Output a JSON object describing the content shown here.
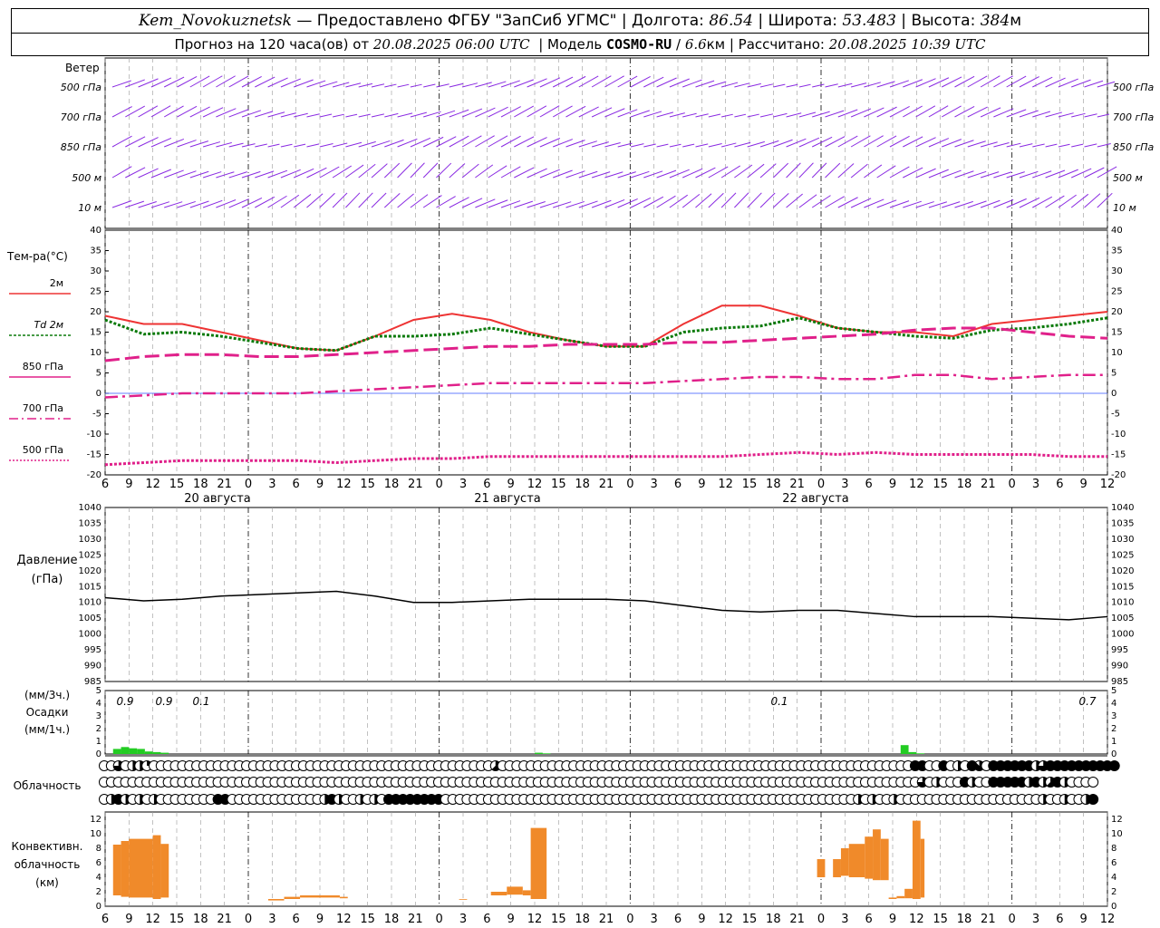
{
  "header": {
    "station": "Kem_Novokuznetsk",
    "sep": " — ",
    "provider": "Предоставлено ФГБУ \"ЗапСиб УГМС\"",
    "lon_label": "Долгота:",
    "lon_value": "86.54",
    "lat_label": "Широта:",
    "lat_value": "53.483",
    "alt_label": "Высота:",
    "alt_value": "384",
    "alt_unit": "м",
    "forecast_label": "Прогноз на 120 часа(ов) от",
    "forecast_time": "20.08.2025 06:00 UTC",
    "model_label": "Модель",
    "model_name": "COSMO-RU",
    "model_res": "6.6",
    "model_res_unit": "км",
    "calc_label": "Рассчитано:",
    "calc_time": "20.08.2025 10:39 UTC"
  },
  "labels": {
    "wind_title": "Ветер",
    "wind_levels": [
      "500 гПа",
      "700 гПа",
      "850 гПа",
      "500 м",
      "10 м"
    ],
    "temp_title": "Тем-ра(°C)",
    "temp_legend": [
      "2м",
      "Td 2м",
      "850 гПа",
      "700 гПа",
      "500 гПа"
    ],
    "pres_title_1": "Давление",
    "pres_title_2": "(гПа)",
    "precip_title_1": "(мм/3ч.)",
    "precip_title_2": "Осадки",
    "precip_title_3": "(мм/1ч.)",
    "cloud_title": "Облачность",
    "conv_title_1": "Конвективн.",
    "conv_title_2": "облачность",
    "conv_title_3": "(км)",
    "dates": [
      "20 августа",
      "21 августа",
      "22 августа"
    ],
    "precip_values": [
      "0.9",
      "0.9",
      "0.1",
      "0.1",
      "0.7"
    ]
  },
  "colors": {
    "wind": "#8a2be2",
    "t2m": "#ee3333",
    "td2m": "#0a7a0a",
    "t850": "#e0208a",
    "precip": "#22cc22",
    "conv": "#f08a2a",
    "grid": "#999999"
  },
  "chart_data": [
    {
      "type": "line",
      "title": "Тем-ра(°C)",
      "x_hours_utc": [
        6,
        9,
        12,
        15,
        18,
        21,
        0,
        3,
        6,
        9,
        12,
        15,
        18,
        21,
        0,
        3,
        6,
        9,
        12,
        15,
        18,
        21,
        0,
        3,
        6,
        9,
        12
      ],
      "ylim": [
        -20,
        40
      ],
      "series": [
        {
          "name": "2м",
          "values": [
            19,
            17,
            17,
            15,
            13,
            11,
            10.5,
            14,
            18,
            19.5,
            18,
            15,
            13,
            11.5,
            11.5,
            17,
            21.5,
            21.5,
            19,
            16,
            15,
            15,
            14,
            17,
            18,
            19,
            20
          ]
        },
        {
          "name": "Td 2м",
          "values": [
            18,
            14.5,
            15,
            14,
            12.5,
            11,
            10.5,
            14,
            14,
            14.5,
            16,
            14.5,
            13,
            11.5,
            11.5,
            15,
            16,
            16.5,
            18.5,
            16,
            15,
            14,
            13.5,
            15.5,
            16,
            17,
            18.5
          ]
        },
        {
          "name": "850 гПа",
          "values": [
            8,
            9,
            9.5,
            9.5,
            9,
            9,
            9.5,
            10,
            10.5,
            11,
            11.5,
            11.5,
            12,
            12,
            12,
            12.5,
            12.5,
            13,
            13.5,
            14,
            14.5,
            15.5,
            16,
            16,
            15,
            14,
            13.5
          ]
        },
        {
          "name": "700 гПа",
          "values": [
            -1,
            -0.5,
            0,
            0,
            0,
            0,
            0.5,
            1,
            1.5,
            2,
            2.5,
            2.5,
            2.5,
            2.5,
            2.5,
            3,
            3.5,
            4,
            4,
            3.5,
            3.5,
            4.5,
            4.5,
            3.5,
            4,
            4.5,
            4.5
          ]
        },
        {
          "name": "500 гПа",
          "values": [
            -17.5,
            -17,
            -16.5,
            -16.5,
            -16.5,
            -16.5,
            -17,
            -16.5,
            -16,
            -16,
            -15.5,
            -15.5,
            -15.5,
            -15.5,
            -15.5,
            -15.5,
            -15.5,
            -15,
            -14.5,
            -15,
            -14.5,
            -15,
            -15,
            -15,
            -15,
            -15.5,
            -15.5
          ]
        }
      ]
    },
    {
      "type": "line",
      "title": "Давление",
      "ylabel": "(гПа)",
      "x_hours_utc": [
        6,
        9,
        12,
        15,
        18,
        21,
        0,
        3,
        6,
        9,
        12,
        15,
        18,
        21,
        0,
        3,
        6,
        9,
        12,
        15,
        18,
        21,
        0,
        3,
        6,
        9,
        12
      ],
      "ylim": [
        985,
        1040
      ],
      "series": [
        {
          "name": "Давление",
          "values": [
            1011.5,
            1010.5,
            1011,
            1012,
            1012.5,
            1013,
            1013.5,
            1012,
            1010,
            1010,
            1010.5,
            1011,
            1011,
            1011,
            1010.5,
            1009,
            1007.5,
            1007,
            1007.5,
            1007.5,
            1006.5,
            1005.5,
            1005.5,
            1005.5,
            1005,
            1004.5,
            1005.5
          ]
        }
      ]
    },
    {
      "type": "bar",
      "title": "Осадки",
      "ylabel": "(мм/1ч.)",
      "ylim": [
        0,
        5
      ],
      "x_hours_utc": [
        7,
        8,
        9,
        10,
        11,
        12,
        13,
        12,
        13,
        10,
        11,
        12
      ],
      "values": [
        0.4,
        0.55,
        0.45,
        0.4,
        0.2,
        0.15,
        0.1,
        0.1,
        0.05,
        0.7,
        0.15,
        0.05
      ],
      "day_index": [
        0,
        0,
        0,
        0,
        0,
        0,
        0,
        2,
        2,
        4,
        4,
        4
      ],
      "totals_3h": [
        "0.9",
        "0.9",
        "0.1",
        "0.1",
        "0.7"
      ]
    },
    {
      "type": "bar",
      "title": "Конвективн. облачность",
      "ylabel": "(км)",
      "ylim": [
        0,
        13
      ],
      "segments": [
        {
          "day": 0,
          "h0": 7,
          "h1": 8,
          "bottom": 1.5,
          "top": 8.5
        },
        {
          "day": 0,
          "h0": 8,
          "h1": 9,
          "bottom": 1.3,
          "top": 9.0
        },
        {
          "day": 0,
          "h0": 9,
          "h1": 12,
          "bottom": 1.2,
          "top": 9.3
        },
        {
          "day": 0,
          "h0": 12,
          "h1": 13,
          "bottom": 1.0,
          "top": 9.8
        },
        {
          "day": 0,
          "h0": 13,
          "h1": 14,
          "bottom": 1.2,
          "top": 8.6
        },
        {
          "day": 1,
          "h0": 2.5,
          "h1": 4.5,
          "bottom": 0.8,
          "top": 1.0
        },
        {
          "day": 1,
          "h0": 4.5,
          "h1": 6.5,
          "bottom": 1.0,
          "top": 1.3
        },
        {
          "day": 1,
          "h0": 6.5,
          "h1": 11.5,
          "bottom": 1.2,
          "top": 1.5
        },
        {
          "day": 1,
          "h0": 11.5,
          "h1": 12.5,
          "bottom": 1.1,
          "top": 1.3
        },
        {
          "day": 2,
          "h0": 2.5,
          "h1": 3.5,
          "bottom": 0.9,
          "top": 1.0
        },
        {
          "day": 2,
          "h0": 6.5,
          "h1": 8.5,
          "bottom": 1.5,
          "top": 2.0
        },
        {
          "day": 2,
          "h0": 8.5,
          "h1": 10.5,
          "bottom": 1.6,
          "top": 2.7
        },
        {
          "day": 2,
          "h0": 10.5,
          "h1": 11.5,
          "bottom": 1.5,
          "top": 2.2
        },
        {
          "day": 2,
          "h0": 11.5,
          "h1": 13.5,
          "bottom": 1.0,
          "top": 10.8
        },
        {
          "day": 3,
          "h0": 23.5,
          "h1": 24.5,
          "bottom": 4.0,
          "top": 6.5
        },
        {
          "day": 4,
          "h0": 1.5,
          "h1": 2.5,
          "bottom": 4.0,
          "top": 6.5
        },
        {
          "day": 4,
          "h0": 2.5,
          "h1": 3.5,
          "bottom": 4.2,
          "top": 8.0
        },
        {
          "day": 4,
          "h0": 3.5,
          "h1": 5.5,
          "bottom": 4.0,
          "top": 8.6
        },
        {
          "day": 4,
          "h0": 5.5,
          "h1": 6.5,
          "bottom": 3.8,
          "top": 9.6
        },
        {
          "day": 4,
          "h0": 6.5,
          "h1": 7.5,
          "bottom": 3.6,
          "top": 10.6
        },
        {
          "day": 4,
          "h0": 7.5,
          "h1": 8.5,
          "bottom": 3.6,
          "top": 9.3
        },
        {
          "day": 4,
          "h0": 8.5,
          "h1": 9.5,
          "bottom": 1.0,
          "top": 1.2
        },
        {
          "day": 4,
          "h0": 9.5,
          "h1": 10.5,
          "bottom": 1.1,
          "top": 1.4
        },
        {
          "day": 4,
          "h0": 10.5,
          "h1": 11.5,
          "bottom": 1.1,
          "top": 2.4
        },
        {
          "day": 4,
          "h0": 11.5,
          "h1": 12.5,
          "bottom": 1.0,
          "top": 11.8
        },
        {
          "day": 4,
          "h0": 12.5,
          "h1": 13,
          "bottom": 1.2,
          "top": 9.3
        }
      ]
    },
    {
      "type": "table",
      "title": "Облачность",
      "rows_cover_eighths": [
        "00604420000000000000000000000000000000000000000000000005000000000000000000000000000000000000000000000000000000000088008040870888888468888888888",
        "00000000000000000000000000000000000000000000000000000000000000000000000000000000000000000000000000000000000000000006040008400888884845840000",
        "04840404000000008800000000000004840040408888888800000000000000000000000000000000000000000000000000000000004040040000000000000000000040040048"
      ]
    }
  ]
}
